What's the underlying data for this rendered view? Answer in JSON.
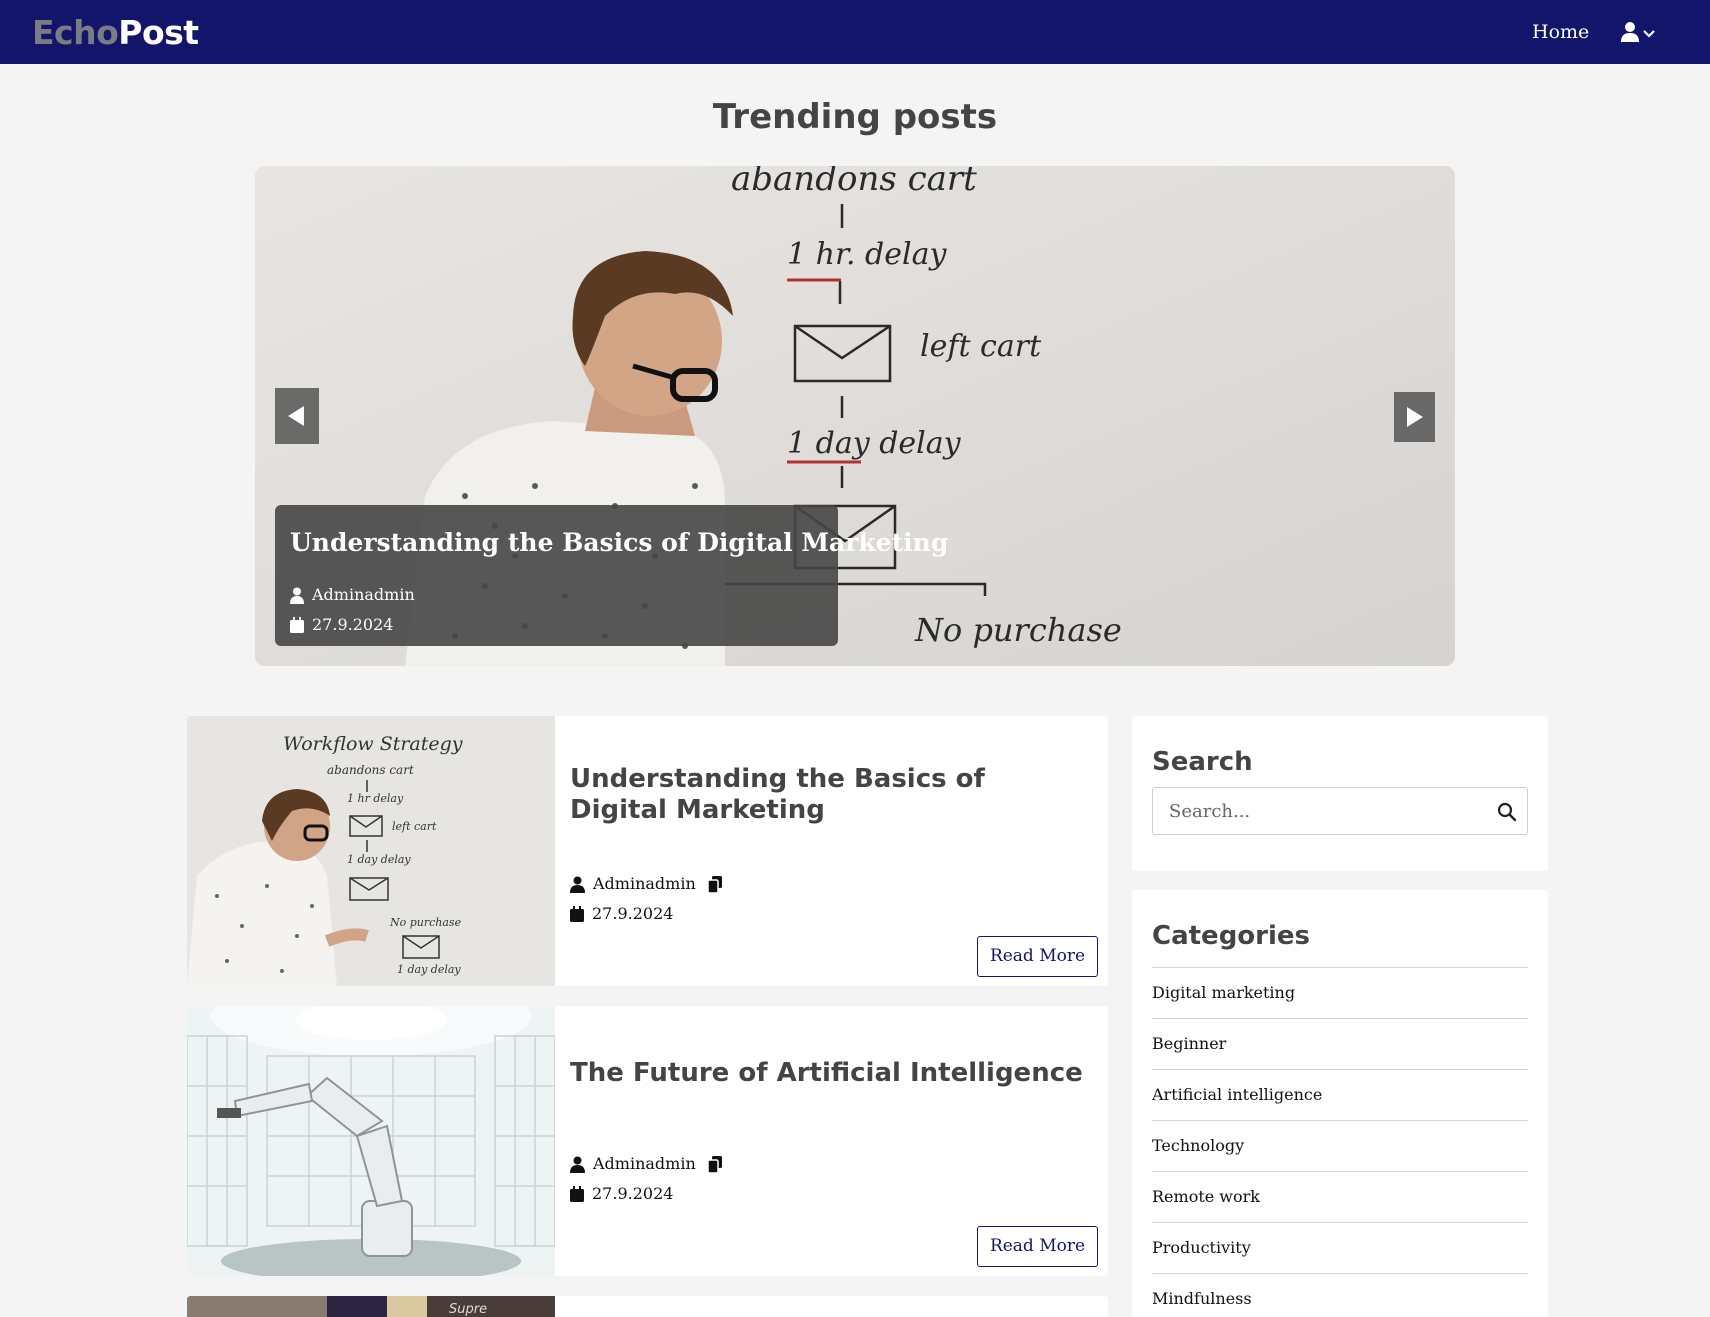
{
  "navbar": {
    "logo_part1": "Echo",
    "logo_part2": "Post",
    "home_label": "Home",
    "user_icon": "user-icon",
    "dropdown_icon": "chevron-down-icon",
    "background": "#12156a"
  },
  "trending": {
    "title": "Trending posts",
    "slide": {
      "title": "Understanding the Basics of Digital Marketing",
      "author": "Adminadmin",
      "date": "27.9.2024"
    }
  },
  "posts": [
    {
      "title": "Understanding the Basics of Digital Marketing",
      "author": "Adminadmin",
      "date": "27.9.2024",
      "read_more": "Read More"
    },
    {
      "title": "The Future of Artificial Intelligence",
      "author": "Adminadmin",
      "date": "27.9.2024",
      "read_more": "Read More"
    }
  ],
  "sidebar": {
    "search_title": "Search",
    "search_placeholder": "Search...",
    "categories_title": "Categories",
    "categories": [
      "Digital marketing",
      "Beginner",
      "Artificial intelligence",
      "Technology",
      "Remote work",
      "Productivity",
      "Mindfulness"
    ]
  },
  "colors": {
    "accent": "#12156a",
    "page_background": "#f4f4f4",
    "heading": "#444444"
  }
}
